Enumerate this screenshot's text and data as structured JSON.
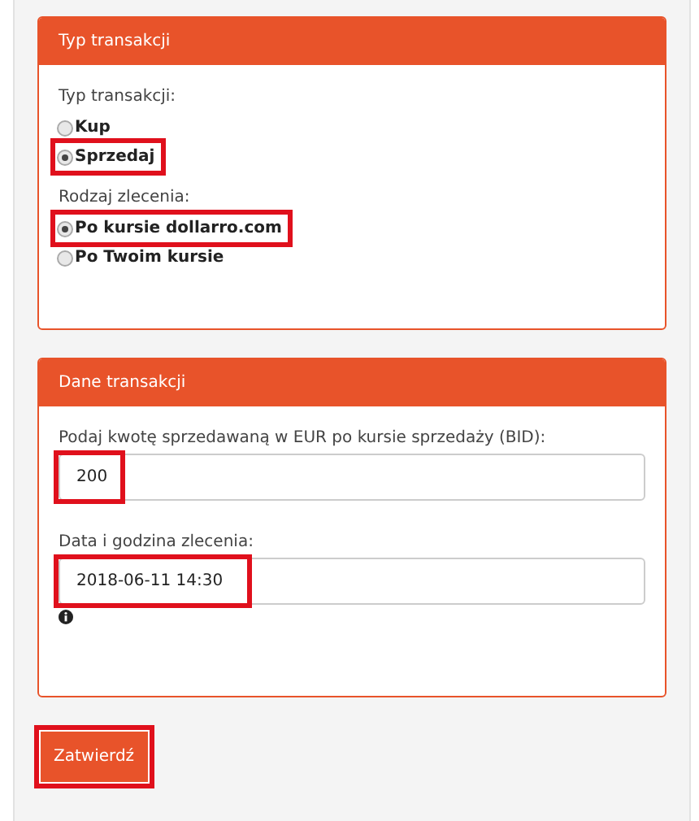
{
  "panels": [
    {
      "title": "Typ transakcji",
      "groups": [
        {
          "label": "Typ transakcji:",
          "options": [
            {
              "label": "Kup",
              "selected": false,
              "highlighted": false
            },
            {
              "label": "Sprzedaj",
              "selected": true,
              "highlighted": true
            }
          ]
        },
        {
          "label": "Rodzaj zlecenia:",
          "options": [
            {
              "label": "Po kursie dollarro.com",
              "selected": true,
              "highlighted": true
            },
            {
              "label": "Po Twoim kursie",
              "selected": false,
              "highlighted": false
            }
          ]
        }
      ]
    },
    {
      "title": "Dane transakcji",
      "fields": [
        {
          "label": "Podaj kwotę sprzedawaną w EUR po kursie sprzedaży (BID):",
          "value": "200",
          "highlighted": true,
          "info": false
        },
        {
          "label": "Data i godzina zlecenia:",
          "value": "2018-06-11 14:30",
          "highlighted": true,
          "info": true
        }
      ]
    }
  ],
  "submit": {
    "label": "Zatwierdź",
    "highlighted": true
  }
}
